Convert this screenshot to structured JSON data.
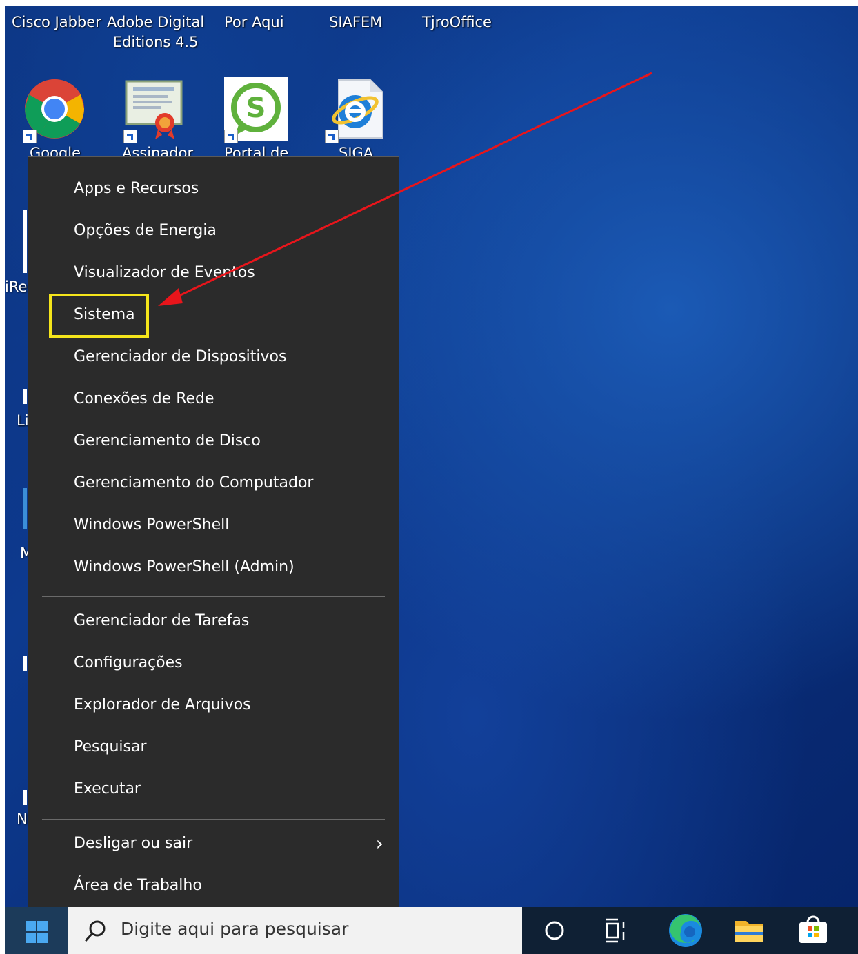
{
  "desktop": {
    "top_row_labels": [
      "Cisco Jabber",
      "Adobe Digital\nEditions 4.5",
      "Por Aqui",
      "SIAFEM",
      "TjroOffice"
    ],
    "second_row_labels": [
      "Google",
      "Assinador",
      "Portal de",
      "SIGA"
    ],
    "left_edge_labels": [
      "iRe",
      "Li",
      "M",
      "N"
    ]
  },
  "context_menu": {
    "items": [
      "Apps e Recursos",
      "Opções de Energia",
      "Visualizador de Eventos",
      "Sistema",
      "Gerenciador de Dispositivos",
      "Conexões de Rede",
      "Gerenciamento de Disco",
      "Gerenciamento do Computador",
      "Windows PowerShell",
      "Windows PowerShell (Admin)",
      "Gerenciador de Tarefas",
      "Configurações",
      "Explorador de Arquivos",
      "Pesquisar",
      "Executar",
      "Desligar ou sair",
      "Área de Trabalho"
    ],
    "highlighted_item": "Sistema",
    "submenu_indicator": "chevron-right"
  },
  "annotation": {
    "highlight_color": "#f5e51b",
    "arrow_color": "#e8151b"
  },
  "taskbar": {
    "search_placeholder": "Digite aqui para pesquisar",
    "icons": [
      "windows-start-icon",
      "search-icon",
      "cortana-circle-icon",
      "task-view-icon",
      "edge-icon",
      "file-explorer-icon",
      "microsoft-store-icon"
    ]
  }
}
